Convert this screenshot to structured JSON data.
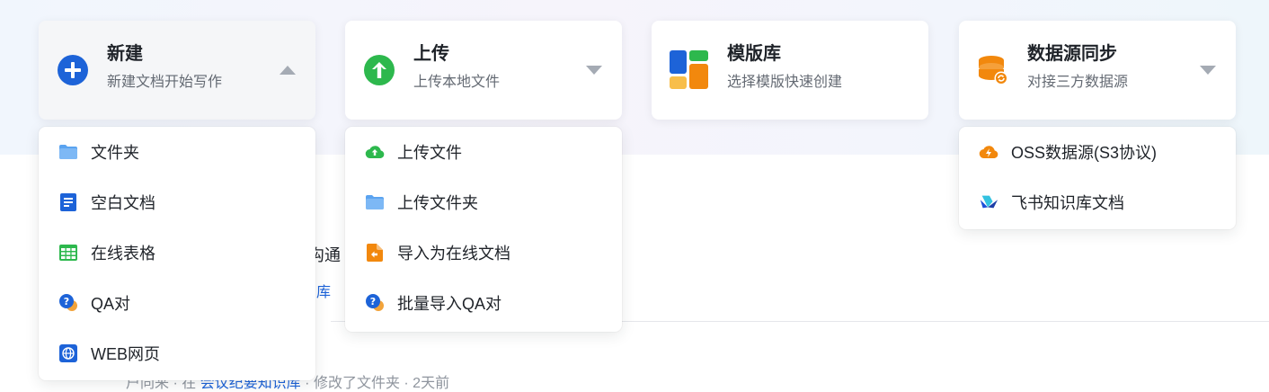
{
  "cards": {
    "new": {
      "title": "新建",
      "subtitle": "新建文档开始写作"
    },
    "upload": {
      "title": "上传",
      "subtitle": "上传本地文件"
    },
    "templates": {
      "title": "模版库",
      "subtitle": "选择模版快速创建"
    },
    "datasource": {
      "title": "数据源同步",
      "subtitle": "对接三方数据源"
    }
  },
  "menus": {
    "new": [
      {
        "label": "文件夹",
        "icon": "folder-icon"
      },
      {
        "label": "空白文档",
        "icon": "document-icon"
      },
      {
        "label": "在线表格",
        "icon": "spreadsheet-icon"
      },
      {
        "label": "QA对",
        "icon": "qa-icon"
      },
      {
        "label": "WEB网页",
        "icon": "globe-icon"
      }
    ],
    "upload": [
      {
        "label": "上传文件",
        "icon": "cloud-upload-icon"
      },
      {
        "label": "上传文件夹",
        "icon": "folder-icon"
      },
      {
        "label": "导入为在线文档",
        "icon": "import-icon"
      },
      {
        "label": "批量导入QA对",
        "icon": "qa-icon"
      }
    ],
    "datasource": [
      {
        "label": "OSS数据源(S3协议)",
        "icon": "oss-icon"
      },
      {
        "label": "飞书知识库文档",
        "icon": "feishu-icon"
      }
    ]
  },
  "background": {
    "partial_text": "沟通",
    "partial_link": "库",
    "meta_author": "户同来",
    "meta_in": "· 在",
    "meta_space": "会议纪要知识库",
    "meta_action": "· 修改了文件夹",
    "meta_time": "· 2天前"
  },
  "colors": {
    "accent_blue": "#1d63d8",
    "upload_green": "#2db84d",
    "data_orange": "#f2880d",
    "caret_gray": "#a5abb4"
  }
}
